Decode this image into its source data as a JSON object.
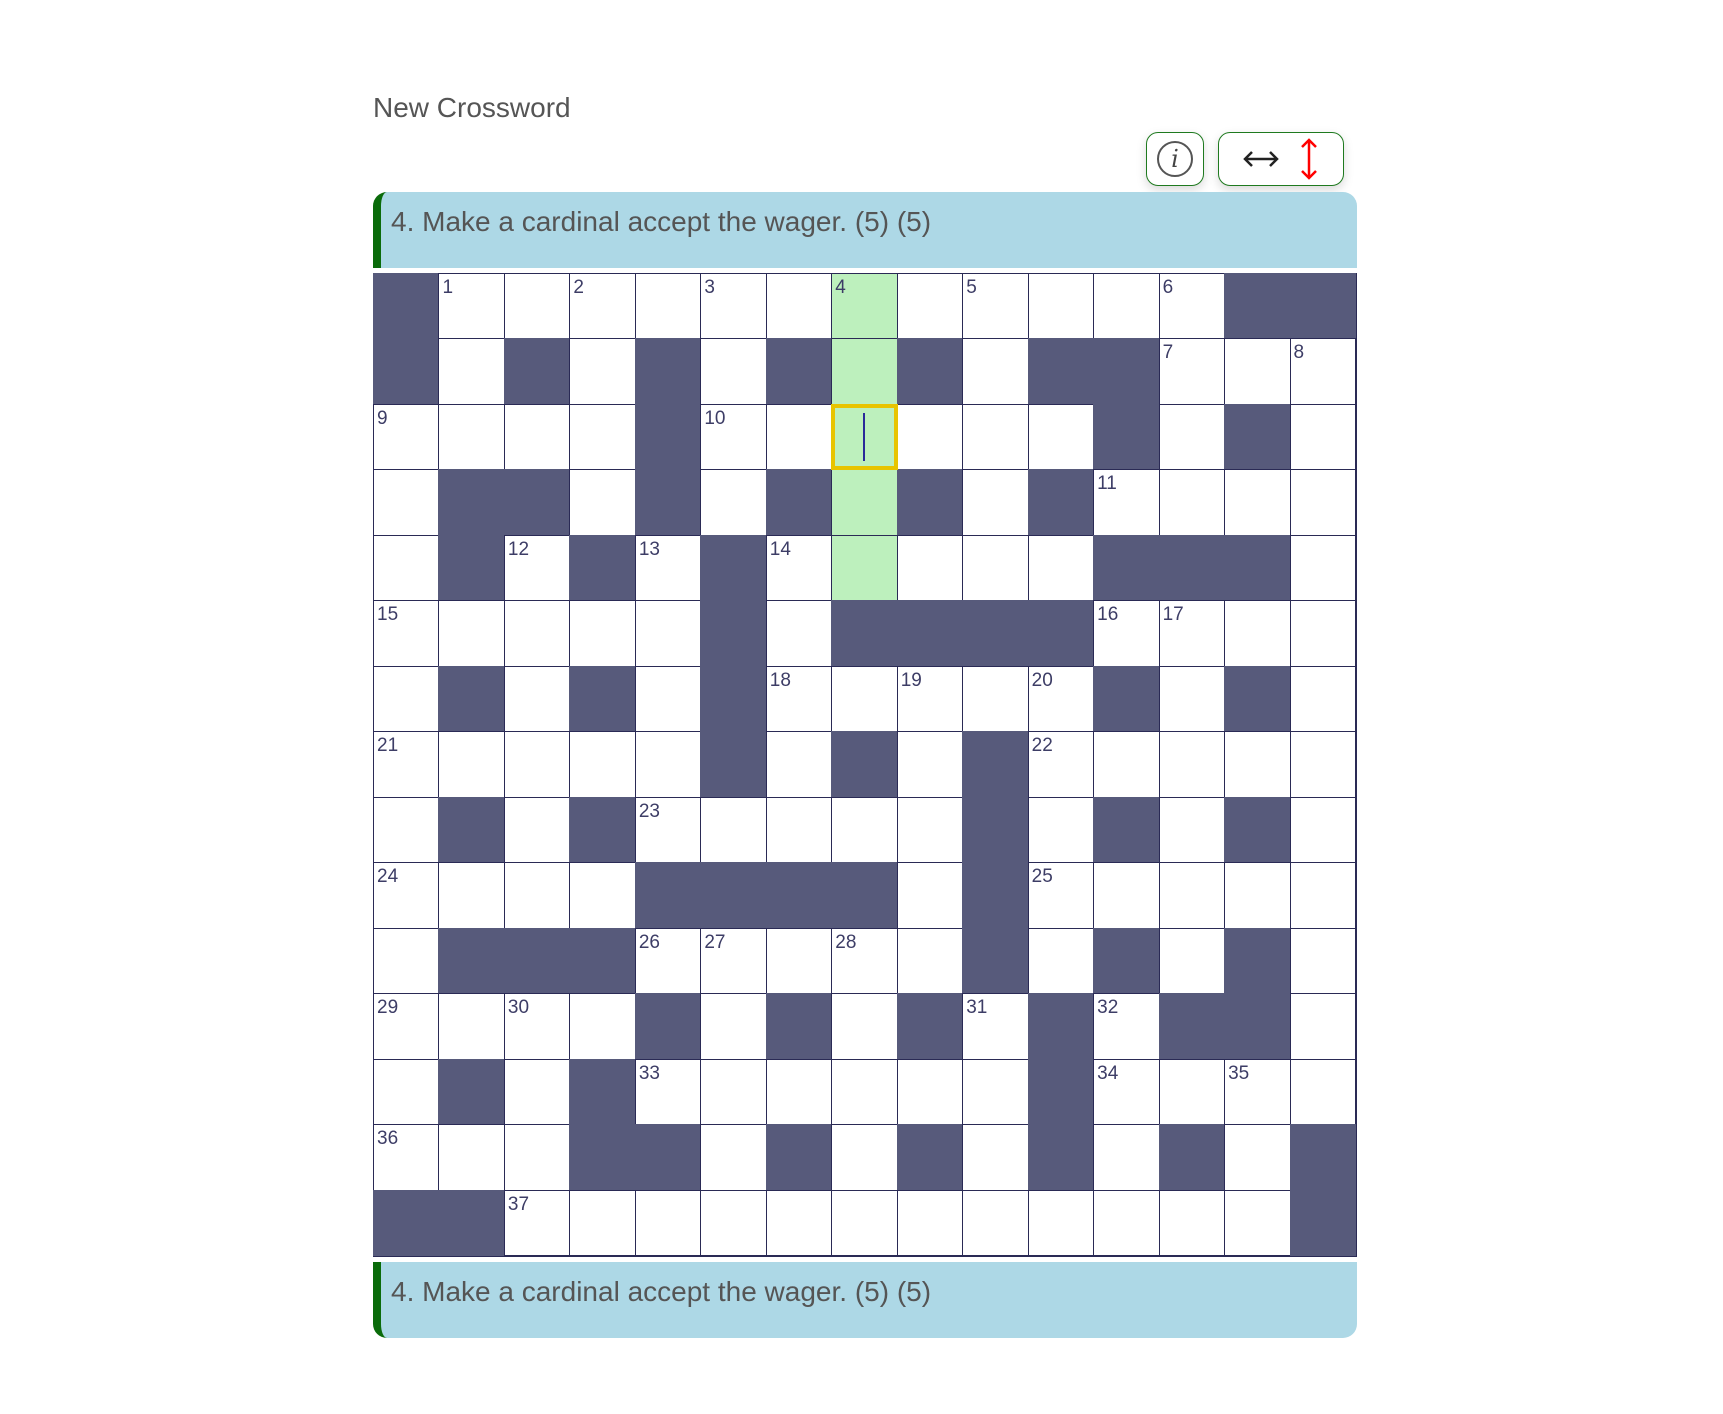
{
  "page": {
    "title": "New Crossword"
  },
  "toolbar": {
    "info_icon": "info-icon",
    "info_glyph": "i",
    "across_icon": "horizontal-arrow-icon",
    "across_glyph": "↔",
    "down_icon": "vertical-arrow-icon",
    "down_glyph": "↕",
    "active_direction": "down",
    "active_color": "#ff0000"
  },
  "clue": {
    "current": "4. Make a cardinal accept the wager. (5) (5)",
    "current_bottom": "4. Make a cardinal accept the wager. (5) (5)"
  },
  "colors": {
    "block": "#575a7b",
    "highlight": "#bdf0bd",
    "active_outline": "#e8c400",
    "clue_bar": "#add8e6",
    "clue_accent": "#0a6b0a"
  },
  "grid": {
    "size": 15,
    "active_cell": [
      2,
      7
    ],
    "highlight_cells": [
      [
        0,
        7
      ],
      [
        1,
        7
      ],
      [
        2,
        7
      ],
      [
        3,
        7
      ],
      [
        4,
        7
      ]
    ],
    "blocks": [
      [
        0,
        0
      ],
      [
        0,
        13
      ],
      [
        0,
        14
      ],
      [
        1,
        0
      ],
      [
        1,
        2
      ],
      [
        1,
        4
      ],
      [
        1,
        6
      ],
      [
        1,
        8
      ],
      [
        1,
        10
      ],
      [
        1,
        11
      ],
      [
        2,
        4
      ],
      [
        2,
        11
      ],
      [
        2,
        13
      ],
      [
        3,
        1
      ],
      [
        3,
        2
      ],
      [
        3,
        4
      ],
      [
        3,
        6
      ],
      [
        3,
        8
      ],
      [
        3,
        10
      ],
      [
        4,
        1
      ],
      [
        4,
        3
      ],
      [
        4,
        5
      ],
      [
        4,
        11
      ],
      [
        4,
        12
      ],
      [
        4,
        13
      ],
      [
        5,
        5
      ],
      [
        5,
        7
      ],
      [
        5,
        8
      ],
      [
        5,
        9
      ],
      [
        5,
        10
      ],
      [
        6,
        1
      ],
      [
        6,
        3
      ],
      [
        6,
        5
      ],
      [
        6,
        11
      ],
      [
        6,
        13
      ],
      [
        7,
        5
      ],
      [
        7,
        7
      ],
      [
        7,
        9
      ],
      [
        8,
        1
      ],
      [
        8,
        3
      ],
      [
        8,
        9
      ],
      [
        8,
        11
      ],
      [
        8,
        13
      ],
      [
        9,
        4
      ],
      [
        9,
        5
      ],
      [
        9,
        6
      ],
      [
        9,
        7
      ],
      [
        9,
        9
      ],
      [
        10,
        1
      ],
      [
        10,
        2
      ],
      [
        10,
        3
      ],
      [
        10,
        9
      ],
      [
        10,
        11
      ],
      [
        10,
        13
      ],
      [
        11,
        4
      ],
      [
        11,
        6
      ],
      [
        11,
        8
      ],
      [
        11,
        10
      ],
      [
        11,
        12
      ],
      [
        11,
        13
      ],
      [
        12,
        1
      ],
      [
        12,
        3
      ],
      [
        12,
        10
      ],
      [
        13,
        3
      ],
      [
        13,
        4
      ],
      [
        13,
        6
      ],
      [
        13,
        8
      ],
      [
        13,
        10
      ],
      [
        13,
        12
      ],
      [
        13,
        14
      ],
      [
        14,
        0
      ],
      [
        14,
        1
      ],
      [
        14,
        14
      ]
    ],
    "numbers": [
      {
        "r": 0,
        "c": 1,
        "n": "1"
      },
      {
        "r": 0,
        "c": 3,
        "n": "2"
      },
      {
        "r": 0,
        "c": 5,
        "n": "3"
      },
      {
        "r": 0,
        "c": 7,
        "n": "4"
      },
      {
        "r": 0,
        "c": 9,
        "n": "5"
      },
      {
        "r": 0,
        "c": 12,
        "n": "6"
      },
      {
        "r": 1,
        "c": 12,
        "n": "7"
      },
      {
        "r": 1,
        "c": 14,
        "n": "8"
      },
      {
        "r": 2,
        "c": 0,
        "n": "9"
      },
      {
        "r": 2,
        "c": 5,
        "n": "10"
      },
      {
        "r": 3,
        "c": 11,
        "n": "11"
      },
      {
        "r": 4,
        "c": 2,
        "n": "12"
      },
      {
        "r": 4,
        "c": 4,
        "n": "13"
      },
      {
        "r": 4,
        "c": 6,
        "n": "14"
      },
      {
        "r": 5,
        "c": 0,
        "n": "15"
      },
      {
        "r": 5,
        "c": 11,
        "n": "16"
      },
      {
        "r": 5,
        "c": 12,
        "n": "17"
      },
      {
        "r": 6,
        "c": 6,
        "n": "18"
      },
      {
        "r": 6,
        "c": 8,
        "n": "19"
      },
      {
        "r": 6,
        "c": 10,
        "n": "20"
      },
      {
        "r": 7,
        "c": 0,
        "n": "21"
      },
      {
        "r": 7,
        "c": 10,
        "n": "22"
      },
      {
        "r": 8,
        "c": 4,
        "n": "23"
      },
      {
        "r": 9,
        "c": 0,
        "n": "24"
      },
      {
        "r": 9,
        "c": 10,
        "n": "25"
      },
      {
        "r": 10,
        "c": 4,
        "n": "26"
      },
      {
        "r": 10,
        "c": 5,
        "n": "27"
      },
      {
        "r": 10,
        "c": 7,
        "n": "28"
      },
      {
        "r": 11,
        "c": 0,
        "n": "29"
      },
      {
        "r": 11,
        "c": 2,
        "n": "30"
      },
      {
        "r": 11,
        "c": 9,
        "n": "31"
      },
      {
        "r": 11,
        "c": 11,
        "n": "32"
      },
      {
        "r": 12,
        "c": 4,
        "n": "33"
      },
      {
        "r": 12,
        "c": 11,
        "n": "34"
      },
      {
        "r": 12,
        "c": 13,
        "n": "35"
      },
      {
        "r": 13,
        "c": 0,
        "n": "36"
      },
      {
        "r": 14,
        "c": 2,
        "n": "37"
      }
    ]
  }
}
